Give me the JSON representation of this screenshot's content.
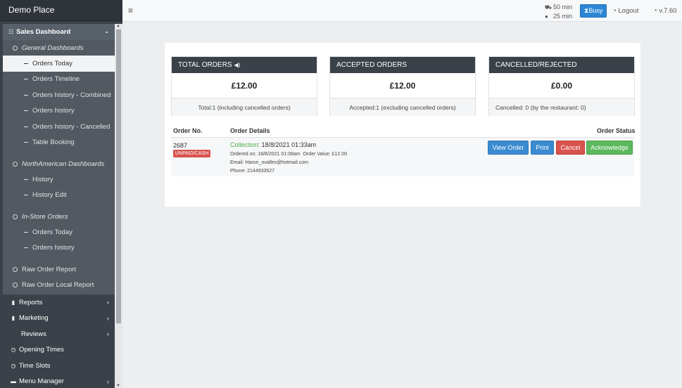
{
  "sidebar": {
    "brand": "Demo Place",
    "active_menu": "Sales Dashboard",
    "general_title": "General Dashboards",
    "general_items": [
      "Orders Today",
      "Orders Timeline",
      "Orders history - Combined",
      "Orders history",
      "Orders history - Cancelled",
      "Table Booking"
    ],
    "northamerican_title": "NorthAmerican Dashboards",
    "northamerican_items": [
      "History",
      "History Edit"
    ],
    "instore_title": "In-Store Orders",
    "instore_items": [
      "Orders Today",
      "Orders history"
    ],
    "raw_items": [
      "Raw Order Report",
      "Raw Order Local Report"
    ],
    "top_items": [
      {
        "label": "Reports",
        "icon": "bar-chart-icon"
      },
      {
        "label": "Marketing",
        "icon": "bar-chart-icon"
      },
      {
        "label": "Reviews",
        "icon": ""
      },
      {
        "label": "Opening Times",
        "icon": "clock-icon"
      },
      {
        "label": "Time Slots",
        "icon": "clock-icon"
      },
      {
        "label": "Menu Manager",
        "icon": "folder-icon"
      }
    ]
  },
  "header": {
    "delivery_time": "50 min",
    "collection_time": "25 min",
    "busy_label": "Busy",
    "logout_label": "Logout",
    "version": "v.7.60"
  },
  "stats": {
    "total": {
      "title": "TOTAL ORDERS",
      "value": "£12.00",
      "footer": "Total:1 (including cancelled orders)"
    },
    "accepted": {
      "title": "ACCEPTED ORDERS",
      "value": "£12.00",
      "footer": "Accepted:1 (excluding cancelled orders)"
    },
    "cancelled": {
      "title": "CANCELLED/REJECTED",
      "value": "£0.00",
      "footer": "Cancelled: 0 (by the restaurant: 0)"
    }
  },
  "table": {
    "headers": {
      "order_no": "Order No.",
      "details": "Order Details",
      "status": "Order Status"
    },
    "row": {
      "order_no": "2687",
      "badge": "UNPAID/CASH",
      "type": "Collection",
      "time": ": 18/8/2021 01:33am",
      "ordered_on": "Ordered on: 18/8/2021 01:08am",
      "order_value": "Order Value: £12.00",
      "email": "Email: Haron_ovalles@hotmail.com",
      "phone": "Phone: 2144933527"
    },
    "actions": {
      "view": "View Order",
      "print": "Print",
      "cancel": "Cancel",
      "acknowledge": "Acknowledge"
    }
  }
}
